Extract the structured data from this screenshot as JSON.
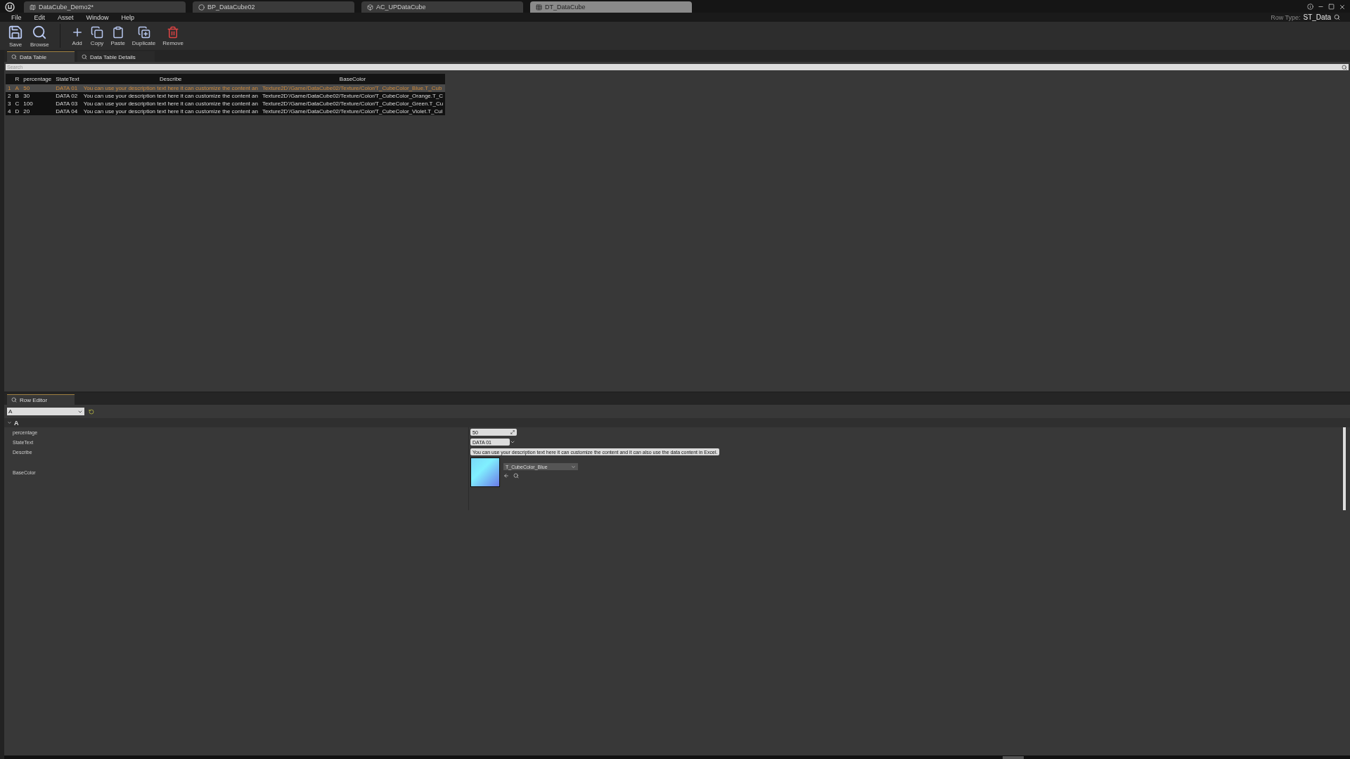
{
  "window_tabs": [
    {
      "label": "DataCube_Demo2*",
      "kind": "level",
      "selected": false
    },
    {
      "label": "BP_DataCube02",
      "kind": "blueprint",
      "selected": false
    },
    {
      "label": "AC_UPDataCube",
      "kind": "component",
      "selected": false
    },
    {
      "label": "DT_DataCube",
      "kind": "table",
      "selected": true
    }
  ],
  "menu": [
    "File",
    "Edit",
    "Asset",
    "Window",
    "Help"
  ],
  "row_type": {
    "label": "Row Type:",
    "value": "ST_Data"
  },
  "toolbar": [
    {
      "label": "Save",
      "kind": "save"
    },
    {
      "label": "Browse",
      "kind": "browse"
    },
    {
      "label": "Add",
      "kind": "add"
    },
    {
      "label": "Copy",
      "kind": "copy"
    },
    {
      "label": "Paste",
      "kind": "paste"
    },
    {
      "label": "Duplicate",
      "kind": "duplicate"
    },
    {
      "label": "Remove",
      "kind": "remove"
    }
  ],
  "panel_tabs": [
    {
      "label": "Data Table",
      "selected": true
    },
    {
      "label": "Data Table Details",
      "selected": false
    }
  ],
  "search": {
    "placeholder": "Search"
  },
  "table": {
    "columns": [
      "",
      "R",
      "percentage",
      "StateText",
      "Describe",
      "BaseColor"
    ],
    "rows": [
      {
        "selected": true,
        "cells": [
          "1",
          "A",
          "50",
          "DATA 01",
          "You can use your description text here it can customize the content an",
          "Texture2D'/Game/DataCube02/Texture/Color/T_CubeColor_Blue.T_Cub"
        ]
      },
      {
        "selected": false,
        "cells": [
          "2",
          "B",
          "30",
          "DATA 02",
          "You can use your description text here it can customize the content an",
          "Texture2D'/Game/DataCube02/Texture/Color/T_CubeColor_Orange.T_C"
        ]
      },
      {
        "selected": false,
        "cells": [
          "3",
          "C",
          "100",
          "DATA 03",
          "You can use your description text here it can customize the content an",
          "Texture2D'/Game/DataCube02/Texture/Color/T_CubeColor_Green.T_Cu"
        ]
      },
      {
        "selected": false,
        "cells": [
          "4",
          "D",
          "20",
          "DATA 04",
          "You can use your description text here it can customize the content an",
          "Texture2D'/Game/DataCube02/Texture/Color/T_CubeColor_Violet.T_Cul"
        ]
      }
    ]
  },
  "row_editor": {
    "tab": "Row Editor",
    "row_select": "A",
    "category": {
      "label": "A",
      "expanded": true
    },
    "properties": [
      {
        "kind": "number",
        "label": "percentage",
        "value": "50"
      },
      {
        "kind": "enum",
        "label": "StateText",
        "value": "DATA 01"
      },
      {
        "kind": "text",
        "label": "Describe",
        "value": "You can use your description text here it can customize the content and it can also use the data content in Excel."
      },
      {
        "kind": "texture",
        "label": "BaseColor",
        "value": "T_CubeColor_Blue"
      }
    ]
  }
}
